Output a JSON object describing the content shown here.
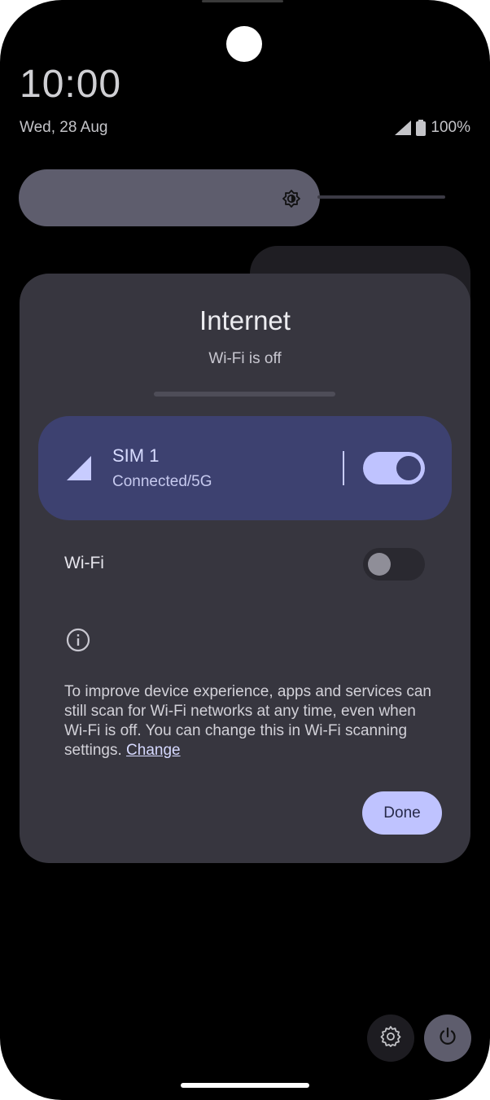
{
  "status_bar": {
    "time": "10:00",
    "date": "Wed, 28 Aug",
    "battery": "100%"
  },
  "icons": {
    "brightness": "brightness-icon",
    "signal": "signal-icon",
    "battery": "battery-icon",
    "info": "info-icon",
    "settings": "gear-icon",
    "power": "power-icon"
  },
  "brightness_slider": {
    "level": 0.68
  },
  "dialog": {
    "title": "Internet",
    "subtitle": "Wi-Fi is off",
    "sim": {
      "name": "SIM 1",
      "status": "Connected/5G",
      "enabled": true
    },
    "wifi": {
      "label": "Wi-Fi",
      "enabled": false
    },
    "info_text": "To improve device experience, apps and services can still scan for Wi-Fi networks at any time, even when Wi-Fi is off. You can change this in Wi-Fi scanning settings.",
    "info_link": "Change",
    "done_label": "Done"
  },
  "colors": {
    "accent": "#bfc3ff",
    "sim_card": "#3d4170",
    "dialog_bg": "#37363f",
    "background": "#000000"
  }
}
